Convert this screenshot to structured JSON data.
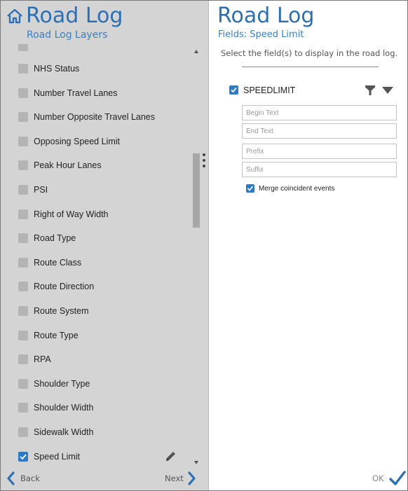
{
  "left_panel": {
    "title": "Road Log",
    "subtitle": "Road Log Layers",
    "items": [
      {
        "label": "NHS Status",
        "checked": false
      },
      {
        "label": "Number Travel Lanes",
        "checked": false
      },
      {
        "label": "Number Opposite Travel Lanes",
        "checked": false
      },
      {
        "label": "Opposing Speed Limit",
        "checked": false
      },
      {
        "label": "Peak Hour Lanes",
        "checked": false
      },
      {
        "label": "PSI",
        "checked": false
      },
      {
        "label": "Right of Way Width",
        "checked": false
      },
      {
        "label": "Road Type",
        "checked": false
      },
      {
        "label": "Route Class",
        "checked": false
      },
      {
        "label": "Route Direction",
        "checked": false
      },
      {
        "label": "Route System",
        "checked": false
      },
      {
        "label": "Route Type",
        "checked": false
      },
      {
        "label": "RPA",
        "checked": false
      },
      {
        "label": "Shoulder Type",
        "checked": false
      },
      {
        "label": "Shoulder Width",
        "checked": false
      },
      {
        "label": "Sidewalk Width",
        "checked": false
      },
      {
        "label": "Speed Limit",
        "checked": true
      }
    ],
    "back_label": "Back",
    "next_label": "Next"
  },
  "right_panel": {
    "title": "Road Log",
    "subtitle": "Fields: Speed Limit",
    "instructions": "Select the field(s) to display in the road log.",
    "field": {
      "name": "SPEEDLIMIT",
      "checked": true
    },
    "inputs": {
      "begin_text_placeholder": "Begin Text",
      "end_text_placeholder": "End Text",
      "prefix_placeholder": "Prefix",
      "suffix_placeholder": "Suffix"
    },
    "merge": {
      "label": "Merge coincident events",
      "checked": true
    },
    "ok_label": "OK"
  },
  "colors": {
    "accent": "#2b6fb5",
    "checkbox_checked": "#2b79c9",
    "checkbox_unchecked": "#b4b4b4",
    "left_bg": "#d4d4d4"
  },
  "icons": {
    "home": "home-icon",
    "pencil": "pencil-icon",
    "filter": "filter-icon",
    "dropdown": "caret-down-icon",
    "back": "chevron-left-icon",
    "next": "chevron-right-icon",
    "ok": "checkmark-icon"
  }
}
